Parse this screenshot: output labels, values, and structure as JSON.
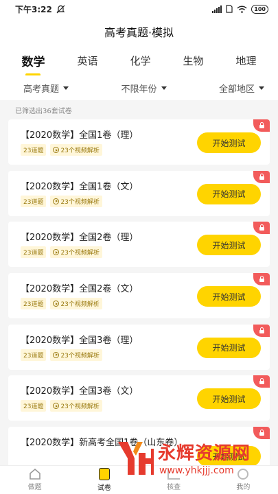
{
  "status": {
    "time": "下午3:22",
    "battery": "100"
  },
  "header": {
    "title": "高考真题·模拟"
  },
  "subjects": [
    "数学",
    "英语",
    "化学",
    "生物",
    "地理"
  ],
  "filters": {
    "type": "高考真题",
    "year": "不限年份",
    "region": "全部地区"
  },
  "count_text": "已筛选出36套试卷",
  "papers": [
    {
      "title": "【2020数学】全国1卷（理）",
      "questions": "23道题",
      "videos": "23个视频解析",
      "button": "开始测试"
    },
    {
      "title": "【2020数学】全国1卷（文）",
      "questions": "23道题",
      "videos": "23个视频解析",
      "button": "开始测试"
    },
    {
      "title": "【2020数学】全国2卷（理）",
      "questions": "23道题",
      "videos": "23个视频解析",
      "button": "开始测试"
    },
    {
      "title": "【2020数学】全国2卷（文）",
      "questions": "23道题",
      "videos": "23个视频解析",
      "button": "开始测试"
    },
    {
      "title": "【2020数学】全国3卷（理）",
      "questions": "23道题",
      "videos": "23个视频解析",
      "button": "开始测试"
    },
    {
      "title": "【2020数学】全国3卷（文）",
      "questions": "23道题",
      "videos": "23个视频解析",
      "button": "开始测试"
    },
    {
      "title": "【2020数学】新高考全国1卷（山东卷）",
      "questions": "",
      "videos": "",
      "button": "开始测试"
    }
  ],
  "nav": {
    "home": "做题",
    "papers": "试卷",
    "stats": "核查",
    "me": "我的"
  },
  "watermark": {
    "name": "永辉资源网",
    "url": "www.yhkjjj.com"
  },
  "colors": {
    "accent": "#ffd400",
    "lock": "#f25b5b",
    "watermark": "#e63b2e"
  }
}
